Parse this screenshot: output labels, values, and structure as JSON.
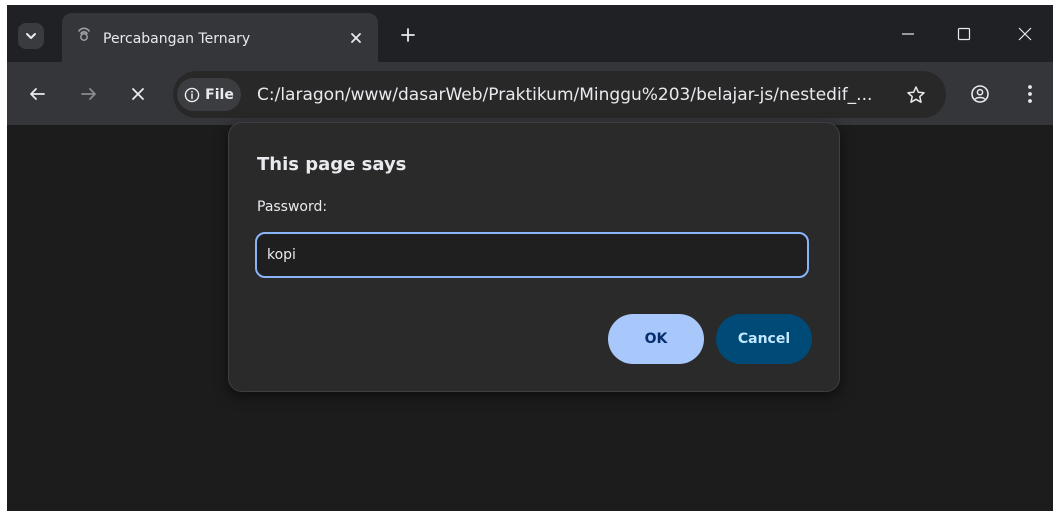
{
  "browser": {
    "tab": {
      "title": "Percabangan Ternary"
    },
    "toolbar": {
      "chip_label": "File",
      "url": "C:/laragon/www/dasarWeb/Praktikum/Minggu%203/belajar-js/nestedif_..."
    },
    "icons": {
      "tab_search": "chevron-down-icon",
      "favicon": "loading-favicon-icon",
      "tab_close": "close-icon",
      "new_tab": "plus-icon",
      "minimize": "minimize-icon",
      "maximize": "maximize-icon",
      "close": "close-icon",
      "back": "back-arrow-icon",
      "forward": "forward-arrow-icon",
      "stop": "stop-icon",
      "info": "info-icon",
      "bookmark": "star-icon",
      "profile": "profile-icon",
      "menu": "more-vert-icon"
    }
  },
  "dialog": {
    "title": "This page says",
    "label": "Password:",
    "input_value": "kopi",
    "ok_label": "OK",
    "cancel_label": "Cancel"
  },
  "colors": {
    "accent": "#8ab4f8",
    "ok_button": "#a8c7fa",
    "cancel_button": "#004a77",
    "tab_active": "#35363a",
    "tab_strip": "#202124",
    "page_background": "#1c1c1c"
  }
}
